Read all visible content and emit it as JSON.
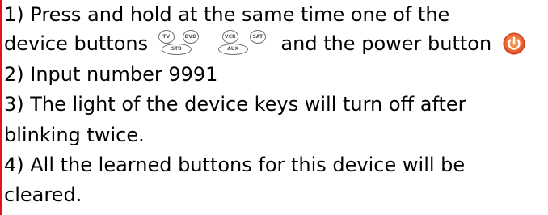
{
  "instructions": {
    "line1": "1) Press and hold at the same time one of the",
    "line2_before": "device buttons",
    "line2_after": "and the power button",
    "line3": "2) Input number 9991",
    "line4": "3) The light of the device keys will turn off after",
    "line5": "blinking twice.",
    "line6": "4) All the learned buttons for this device will be",
    "line7": "cleared."
  },
  "device_buttons": {
    "tv": "TV",
    "dvd": "DVD",
    "vcr": "VCR",
    "sat": "SAT",
    "stb": "STB",
    "aux": "AUX"
  },
  "colors": {
    "border_accent": "#e0141b",
    "power_outer": "#e8502e",
    "power_inner": "#f5a05a",
    "power_symbol": "#ffffff",
    "button_outline": "#6e6e6e"
  },
  "icons": {
    "power": "power-button-icon",
    "device": "device-button-icon"
  }
}
